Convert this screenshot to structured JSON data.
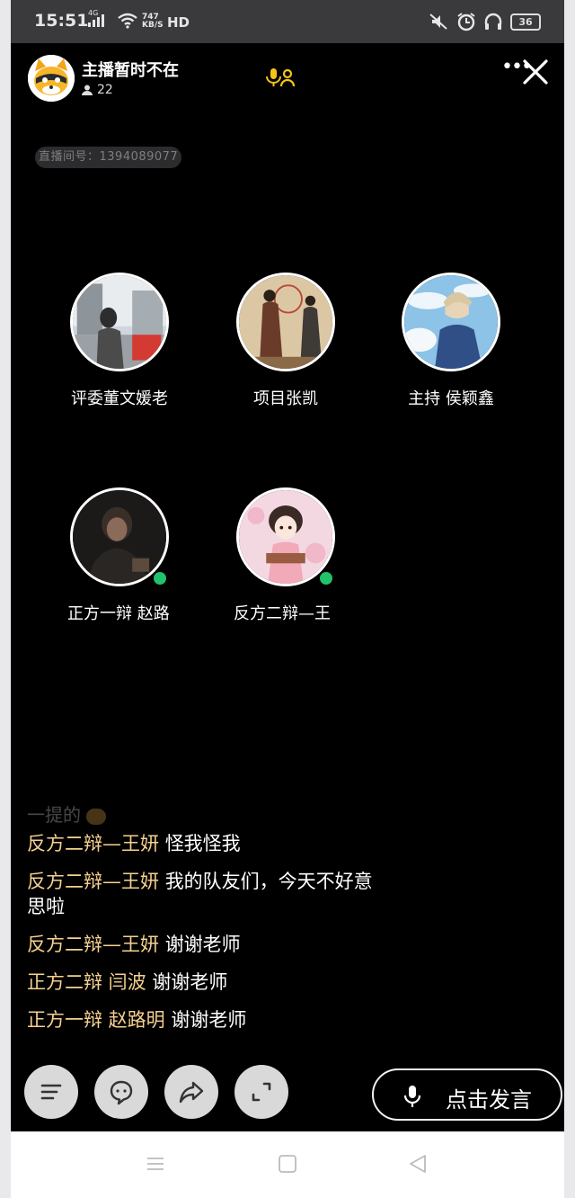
{
  "status_bar": {
    "time": "15:51",
    "network": "4G",
    "speed_value": "747",
    "speed_unit": "KB/S",
    "hd": "HD",
    "battery": "36",
    "icons": [
      "signal-icon",
      "wifi-icon",
      "mute-icon",
      "alarm-icon",
      "headset-icon",
      "battery-icon"
    ]
  },
  "header": {
    "host_status": "主播暂时不在",
    "viewer_count": "22",
    "room_id": "直播间号：1394089077"
  },
  "seats": [
    {
      "label": "评委董文媛老"
    },
    {
      "label": "项目张凯"
    },
    {
      "label": "主持 侯颖鑫"
    },
    {
      "label": "正方一辩 赵路"
    },
    {
      "label": "反方二辩—王"
    }
  ],
  "chat": {
    "faded_line": "一提的",
    "messages": [
      {
        "sender": "反方二辩—王妍",
        "text": "怪我怪我"
      },
      {
        "sender": "反方二辩—王妍",
        "text": "我的队友们，今天不好意思啦"
      },
      {
        "sender": "反方二辩—王妍",
        "text": "谢谢老师"
      },
      {
        "sender": "正方二辩 闫波",
        "text": "谢谢老师"
      },
      {
        "sender": "正方一辩 赵路明",
        "text": "谢谢老师"
      }
    ]
  },
  "bottom_bar": {
    "speak_label": "点击发言"
  },
  "colors": {
    "background": "#000000",
    "sender_name": "#f6d190",
    "online_dot": "#21c36a",
    "mic_icon": "#f5c518"
  }
}
